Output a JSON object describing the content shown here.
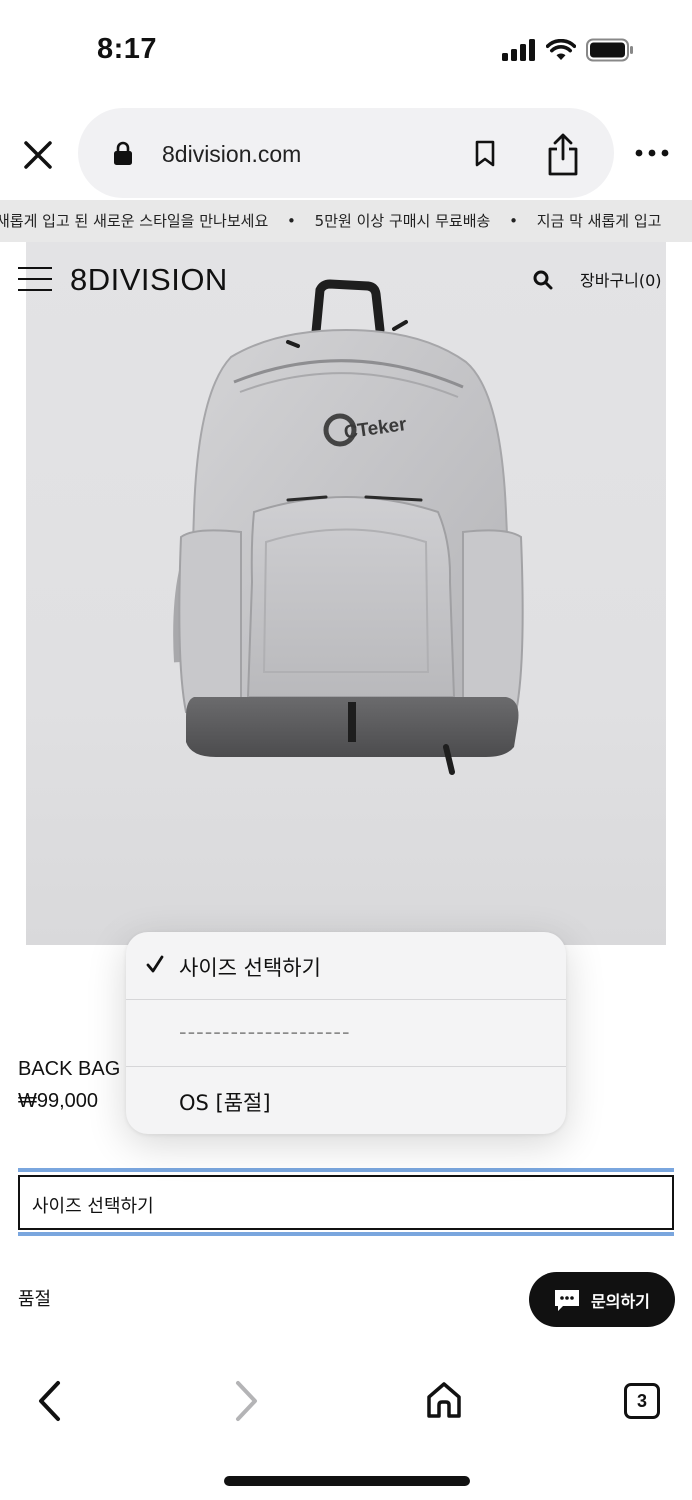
{
  "status_bar": {
    "time": "8:17"
  },
  "browser": {
    "url": "8division.com",
    "icons": {
      "close": "close-icon",
      "lock": "lock-icon",
      "bookmark": "bookmark-icon",
      "share": "share-icon",
      "more": "more-icon"
    }
  },
  "ticker": {
    "items": [
      "새롭게 입고 된 새로운 스타일을 만나보세요",
      "•",
      "5만원 이상 구매시 무료배송",
      "•",
      "지금 막 새롭게 입고"
    ]
  },
  "header": {
    "brand": "8DIVISION",
    "cart_label": "장바구니(0)",
    "icons": {
      "menu": "hamburger-icon",
      "search": "search-icon"
    }
  },
  "product": {
    "name": "BACK BAG",
    "price": "₩99,000",
    "image_logo_text": "CTeker"
  },
  "size_select": {
    "value": "사이즈 선택하기"
  },
  "dropdown": {
    "options": [
      {
        "label": "사이즈 선택하기",
        "selected": true
      },
      {
        "label": "--------------------",
        "selected": false
      },
      {
        "label": "OS [품절]",
        "selected": false
      }
    ]
  },
  "stock_status": "품절",
  "inquiry_button": {
    "label": "문의하기",
    "icon": "chat-icon"
  },
  "bottom_nav": {
    "tab_count": "3",
    "icons": [
      "back-icon",
      "forward-icon",
      "home-icon",
      "tabs-icon"
    ]
  },
  "colors": {
    "accent_border": "#7aa6de",
    "button_bg": "#111111",
    "ticker_bg": "#e8e8e8"
  }
}
